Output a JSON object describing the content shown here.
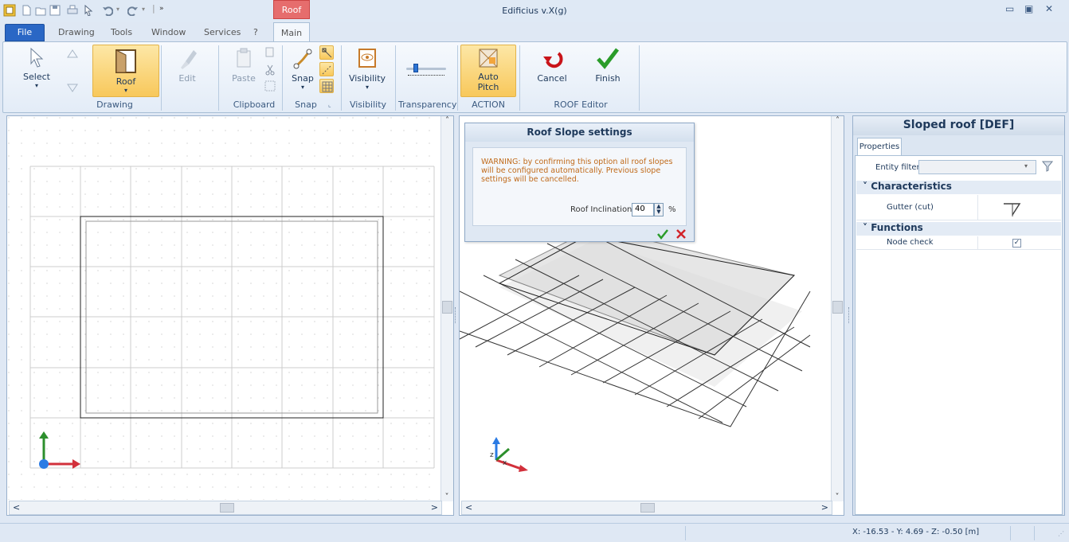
{
  "window": {
    "title": "Edificius v.X(g)",
    "context_tab": "Roof"
  },
  "menu": {
    "file": "File",
    "tabs": [
      "Drawing",
      "Tools",
      "Window",
      "Services",
      "?"
    ],
    "main": "Main"
  },
  "ribbon": {
    "select": "Select",
    "roof": "Roof",
    "edit": "Edit",
    "paste": "Paste",
    "snap": "Snap",
    "visibility": "Visibility",
    "auto_pitch_1": "Auto",
    "auto_pitch_2": "Pitch",
    "cancel": "Cancel",
    "finish": "Finish",
    "groups": {
      "drawing": "Drawing",
      "clipboard": "Clipboard",
      "snap": "Snap",
      "visibility": "Visibility",
      "transparency": "Transparency",
      "action": "ACTION",
      "roof_editor": "ROOF Editor"
    }
  },
  "dialog": {
    "title": "Roof Slope settings",
    "warning": "WARNING: by confirming this option all roof slopes will be configured automatically. Previous slope settings will be cancelled.",
    "inclination_label": "Roof Inclination:",
    "inclination_value": "40",
    "unit": "%"
  },
  "panel": {
    "title": "Sloped roof [DEF]",
    "tab": "Properties",
    "entity_filter": "Entity filter",
    "characteristics": "Characteristics",
    "gutter": "Gutter (cut)",
    "functions": "Functions",
    "node_check": "Node check",
    "node_check_value": true
  },
  "status": {
    "coords": "X: -16.53 - Y: 4.69 - Z: -0.50 [m]"
  },
  "colors": {
    "accent": "#2a67c5",
    "roof_tab": "#e66d6d",
    "highlight": "#f8c85b"
  }
}
